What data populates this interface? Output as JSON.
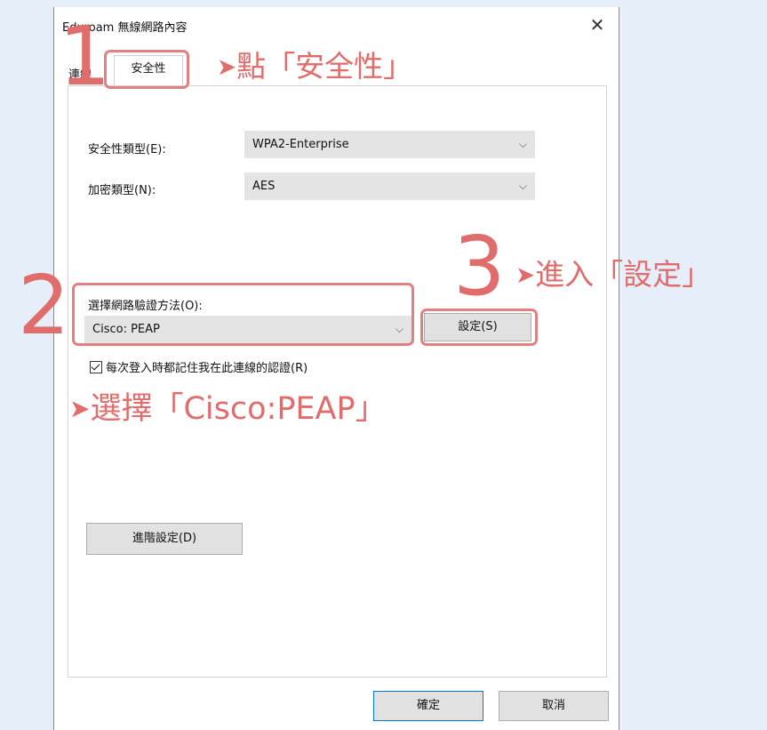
{
  "dialog": {
    "title": "Eduroam 無線網路內容",
    "close_symbol": "✕",
    "tabs": [
      {
        "label": "連線"
      },
      {
        "label": "安全性",
        "selected": true
      }
    ]
  },
  "security": {
    "security_type_label": "安全性類型(E):",
    "security_type_value": "WPA2-Enterprise",
    "encryption_type_label": "加密類型(N):",
    "encryption_type_value": "AES",
    "auth_method_label": "選擇網路驗證方法(O):",
    "auth_method_value": "Cisco: PEAP",
    "settings_button": "設定(S)",
    "remember_checkbox_label": "每次登入時都記住我在此連線的認證(R)",
    "remember_checked": true,
    "advanced_button": "進階設定(D)"
  },
  "footer": {
    "ok_button": "確定",
    "cancel_button": "取消"
  },
  "annotations": {
    "color": "#e06c6c",
    "arrow": "➤",
    "step1_number": "1",
    "step1_text": "點「安全性」",
    "step2_number": "2",
    "step2_text": "選擇「Cisco:PEAP」",
    "step3_number": "3",
    "step3_text": "進入「設定」"
  },
  "icons": {
    "chevron": "chevron-down-icon",
    "close": "close-icon",
    "check": "checkbox-checked-icon"
  }
}
